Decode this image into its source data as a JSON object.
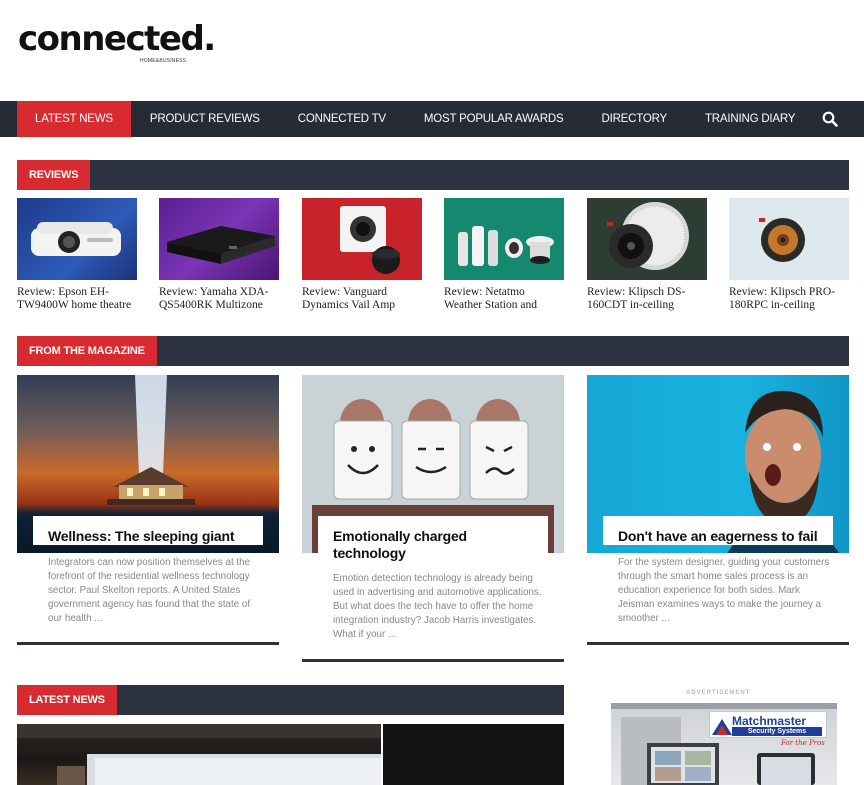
{
  "logo": {
    "main": "connected",
    "dot": ".",
    "sub": "HOME&BUSINESS"
  },
  "nav": {
    "items": [
      {
        "label": "LATEST NEWS"
      },
      {
        "label": "PRODUCT REVIEWS"
      },
      {
        "label": "CONNECTED TV"
      },
      {
        "label": "MOST POPULAR AWARDS"
      },
      {
        "label": "DIRECTORY"
      },
      {
        "label": "TRAINING DIARY"
      }
    ],
    "search_icon": "search-icon"
  },
  "reviews": {
    "heading": "REVIEWS",
    "items": [
      {
        "title": "Review: Epson EH-TW9400W home theatre"
      },
      {
        "title": "Review: Yamaha XDA-QS5400RK Multizone"
      },
      {
        "title": "Review: Vanguard Dynamics Vail Amp"
      },
      {
        "title": "Review: Netatmo Weather Station and"
      },
      {
        "title": "Review: Klipsch DS-160CDT in-ceiling"
      },
      {
        "title": "Review: Klipsch PRO-180RPC in-ceiling"
      }
    ]
  },
  "magazine": {
    "heading": "FROM THE MAGAZINE",
    "cards": [
      {
        "title": "Wellness: The sleeping giant",
        "text": "Integrators can now position themselves at the forefront of the residential wellness technology sector. Paul Skelton reports. A United States government agency has found that the state of our health ..."
      },
      {
        "title": "Emotionally charged technology",
        "text": "Emotion detection technology is already being used in advertising and automotive applications. But what does the tech have to offer the home integration industry? Jacob Harris investigates. What if your ..."
      },
      {
        "title": "Don't have an eagerness to fail",
        "text": "For the system designer, guiding your customers through the smart home sales process is an education experience for both sides. Mark Jeisman examines ways to make the journey a smoother ..."
      }
    ]
  },
  "latest": {
    "heading": "LATEST NEWS"
  },
  "advert": {
    "label": "ADVERTISEMENT",
    "brand": "Matchmaster",
    "brand_sub": "Security Systems",
    "tagline": "For the Pros"
  },
  "colors": {
    "accent": "#d72b31",
    "nav_bg": "#262b36",
    "section_bg": "#2d3240"
  }
}
